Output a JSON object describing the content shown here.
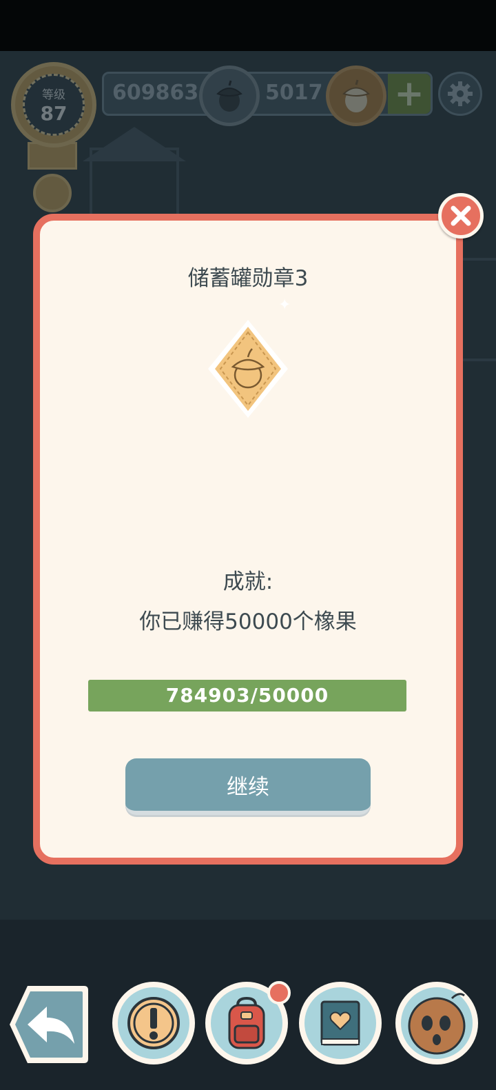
{
  "hud": {
    "level_label": "等级",
    "level_value": "87",
    "acorns": "609863",
    "golden_acorns": "5017",
    "add_label": "+"
  },
  "modal": {
    "title": "储蓄罐勋章3",
    "achievement_label": "成就:",
    "achievement_desc": "你已赚得50000个橡果",
    "progress_text": "784903/50000",
    "progress_fraction": 1.0,
    "continue_label": "继续"
  },
  "icons": {
    "close": "close-icon",
    "badge": "acorn-badge-icon",
    "settings": "gear-icon",
    "back": "back-arrow-icon",
    "alert": "exclamation-icon",
    "backpack": "backpack-icon",
    "book": "heart-book-icon",
    "avatar": "acorn-character-icon"
  },
  "colors": {
    "modal_border": "#e6705f",
    "modal_bg": "#fdf6ec",
    "progress_fill": "#77a45c",
    "continue_bg": "#75a0ac"
  }
}
